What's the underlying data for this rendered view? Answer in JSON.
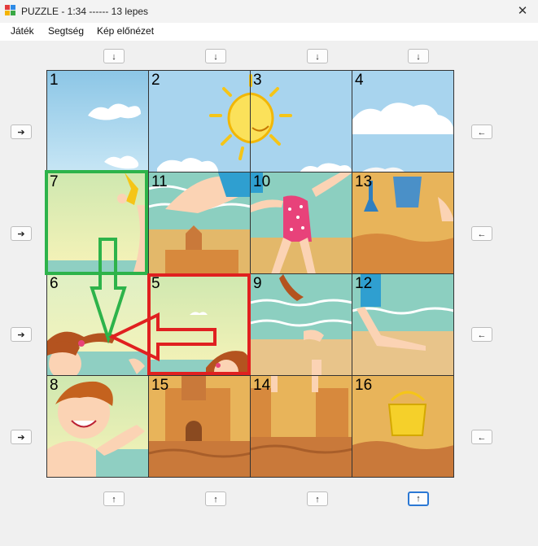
{
  "window": {
    "title": "PUZZLE - 1:34 ------ 13 lepes",
    "close_icon": "close-icon",
    "app_icon": "puzzle-app-icon"
  },
  "menu": {
    "items": [
      "Játék",
      "Segtség",
      "Kép előnézet"
    ]
  },
  "arrows": {
    "down": "↓",
    "up": "↑",
    "right": "➔",
    "left": "←"
  },
  "board": {
    "rows": [
      [
        "1",
        "2",
        "3",
        "4"
      ],
      [
        "7",
        "11",
        "10",
        "13"
      ],
      [
        "6",
        "5",
        "9",
        "12"
      ],
      [
        "8",
        "15",
        "14",
        "16"
      ]
    ]
  },
  "colors": {
    "highlight_green": "#2db34a",
    "highlight_red": "#e02020",
    "focus_blue": "#2b78d4"
  }
}
